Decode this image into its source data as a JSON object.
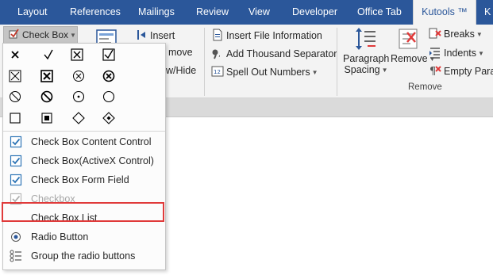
{
  "tabs": [
    {
      "label": "Layout"
    },
    {
      "label": "References"
    },
    {
      "label": "Mailings"
    },
    {
      "label": "Review"
    },
    {
      "label": "View"
    },
    {
      "label": "Developer"
    },
    {
      "label": "Office Tab"
    },
    {
      "label": "Kutools ™"
    },
    {
      "label": "K"
    }
  ],
  "active_tab": "Kutools ™",
  "ribbon": {
    "checkbox_button": "Check Box",
    "insert": "Insert",
    "remove_partial": "move",
    "show_hide_partial": "w/Hide",
    "insert_file_info": "Insert File Information",
    "add_thousand_sep": "Add Thousand Separator",
    "spell_out_numbers": "Spell Out Numbers",
    "paragraph_spacing_1": "Paragraph",
    "paragraph_spacing_2": "Spacing",
    "remove": "Remove",
    "breaks": "Breaks",
    "indents": "Indents",
    "empty_para": "Empty Para",
    "group_remove": "Remove"
  },
  "menu": {
    "symbol_rows": [
      [
        "x-mark",
        "check-mark",
        "boxed-x",
        "boxed-check"
      ],
      [
        "boxed-x-thin",
        "boxed-x-bold",
        "circled-x-thin",
        "circled-x-bold"
      ],
      [
        "circle-slash-thin",
        "circle-slash-bold",
        "circle-dot",
        "circle-empty"
      ],
      [
        "square-empty",
        "square-filled",
        "diamond-empty",
        "diamond-dot"
      ]
    ],
    "items": [
      {
        "label": "Check Box Content Control",
        "icon": "checked-box-icon",
        "disabled": false
      },
      {
        "label": "Check Box(ActiveX Control)",
        "icon": "checked-box-icon",
        "disabled": false
      },
      {
        "label": "Check Box Form Field",
        "icon": "checked-box-icon",
        "disabled": false
      },
      {
        "label": "Checkbox",
        "icon": "checked-box-icon",
        "disabled": true
      },
      {
        "label": "Check Box List",
        "icon": "",
        "disabled": false
      },
      {
        "label": "Radio Button",
        "icon": "radio-button-icon",
        "disabled": false
      },
      {
        "label": "Group the radio buttons",
        "icon": "radio-list-icon",
        "disabled": false
      }
    ]
  },
  "colors": {
    "ribbon_blue": "#2b579a",
    "check_blue": "#2e75b6",
    "highlight_red": "#e03a3a"
  }
}
